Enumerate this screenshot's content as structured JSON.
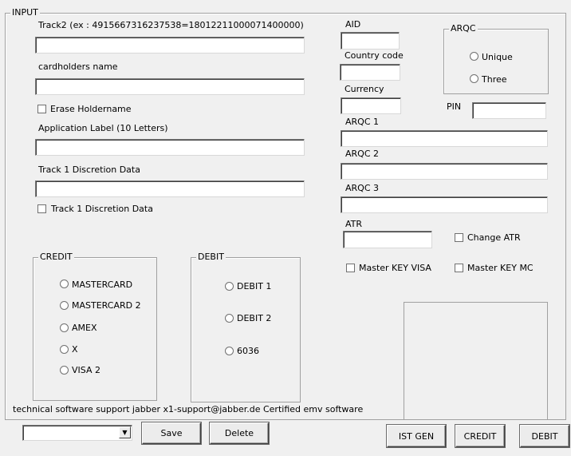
{
  "input_group": {
    "title": "INPUT",
    "track2_label": "Track2 (ex : 4915667316237538=18012211000071400000)",
    "track2_value": "",
    "cardholder_label": "cardholders name",
    "cardholder_value": "",
    "erase_holdername_label": "Erase Holdername",
    "app_label_label": "Application Label (10 Letters)",
    "app_label_value": "",
    "track1_data_label": "Track 1 Discretion Data",
    "track1_data_value": "",
    "track1_check_label": "Track 1 Discretion Data",
    "aid_label": "AID",
    "country_code_label": "Country code",
    "currency_label": "Currency",
    "pin_label": "PIN",
    "arqc1_label": "ARQC 1",
    "arqc2_label": "ARQC 2",
    "arqc3_label": "ARQC 3",
    "atr_label": "ATR",
    "change_atr_label": "Change ATR",
    "master_key_visa_label": "Master KEY VISA",
    "master_key_mc_label": "Master KEY MC",
    "support_text": "technical software support jabber x1-support@jabber.de Certified emv software"
  },
  "arqc_group": {
    "title": "ARQC",
    "options": [
      "Unique",
      "Three"
    ]
  },
  "credit_group": {
    "title": "CREDIT",
    "options": [
      "MASTERCARD",
      "MASTERCARD 2",
      "AMEX",
      "X",
      "VISA 2"
    ]
  },
  "debit_group": {
    "title": "DEBIT",
    "options": [
      "DEBIT 1",
      "DEBIT 2",
      "6036"
    ]
  },
  "bottom_bar": {
    "combo_value": "",
    "save_label": "Save",
    "delete_label": "Delete",
    "ist_gen_label": "IST GEN",
    "credit_label": "CREDIT",
    "debit_label": "DEBIT"
  }
}
